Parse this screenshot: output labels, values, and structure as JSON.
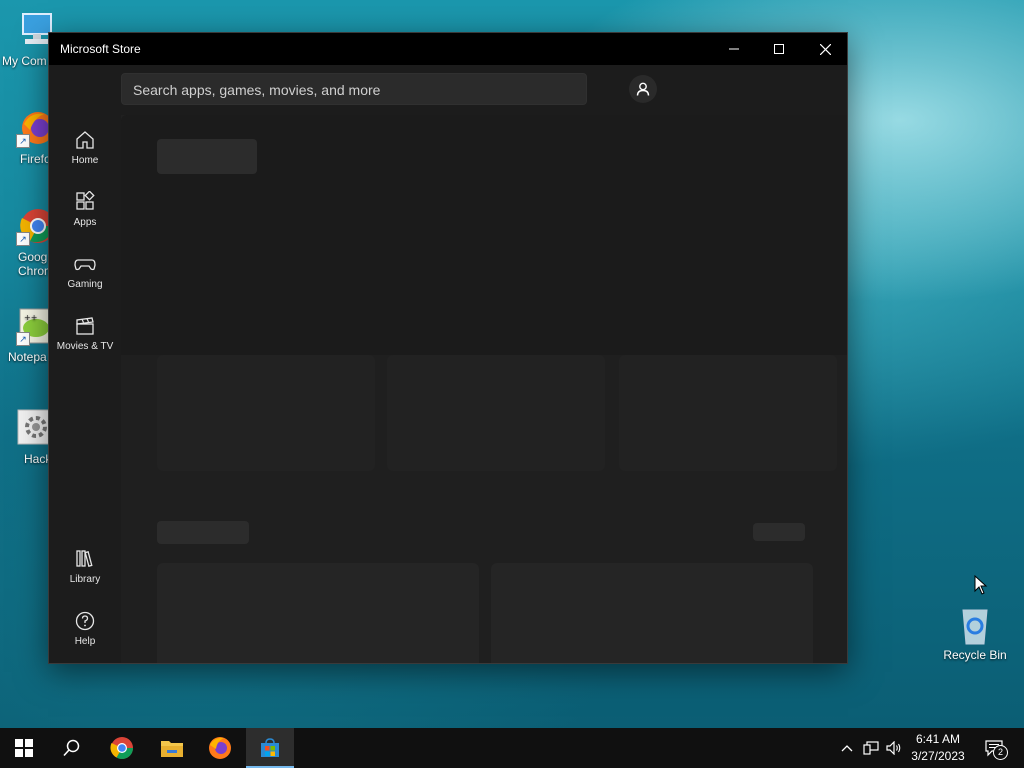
{
  "desktop": {
    "icons": [
      {
        "label": "My Com"
      },
      {
        "label": "Firefo"
      },
      {
        "label": "Goog\nChrom"
      },
      {
        "label": "Notepa"
      },
      {
        "label": "Hack"
      },
      {
        "label": "Recycle Bin"
      }
    ]
  },
  "window": {
    "title": "Microsoft Store",
    "search": {
      "placeholder": "Search apps, games, movies, and more"
    },
    "nav": {
      "home": "Home",
      "apps": "Apps",
      "gaming": "Gaming",
      "movies_tv": "Movies & TV",
      "library": "Library",
      "help": "Help"
    }
  },
  "taskbar": {
    "time": "6:41 AM",
    "date": "3/27/2023",
    "notification_count": "2"
  },
  "colors": {
    "accent": "#76b9ed",
    "window_bg": "#202020",
    "titlebar_bg": "#000000",
    "taskbar_bg": "#101010"
  }
}
